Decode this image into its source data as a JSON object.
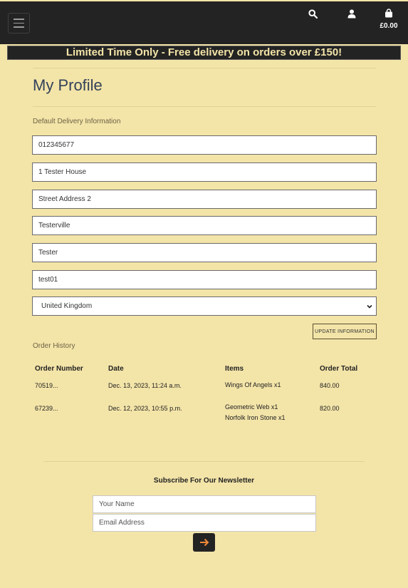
{
  "header": {
    "cart_total": "£0.00",
    "icons": [
      "menu-icon",
      "search-icon",
      "user-icon",
      "shopping-bag-icon"
    ]
  },
  "banner": {
    "text": "Limited Time Only - Free delivery on orders over £150!"
  },
  "profile": {
    "title": "My Profile",
    "delivery_label": "Default Delivery Information",
    "fields": {
      "phone": "012345677",
      "street1": "1 Tester House",
      "street2": "Street Address 2",
      "town": "Testerville",
      "county": "Tester",
      "postcode": "test01",
      "country": "United Kingdom"
    },
    "update_button": "UPDATE INFORMATION"
  },
  "orders": {
    "label": "Order History",
    "headers": [
      "Order Number",
      "Date",
      "Items",
      "Order Total"
    ],
    "rows": [
      {
        "number": "70519...",
        "date": "Dec. 13, 2023, 11:24 a.m.",
        "items": [
          "Wings Of Angels x1"
        ],
        "total": "840.00"
      },
      {
        "number": "67239...",
        "date": "Dec. 12, 2023, 10:55 p.m.",
        "items": [
          "Geometric Web x1",
          "Norfolk Iron Stone x1"
        ],
        "total": "820.00"
      }
    ]
  },
  "newsletter": {
    "title": "Subscribe For Our Newsletter",
    "name_placeholder": "Your Name",
    "email_placeholder": "Email Address"
  },
  "colors": {
    "page_bg": "#f3e4a8",
    "dark": "#232323",
    "accent_orange": "#f0883a",
    "title_blue": "#33425a"
  }
}
